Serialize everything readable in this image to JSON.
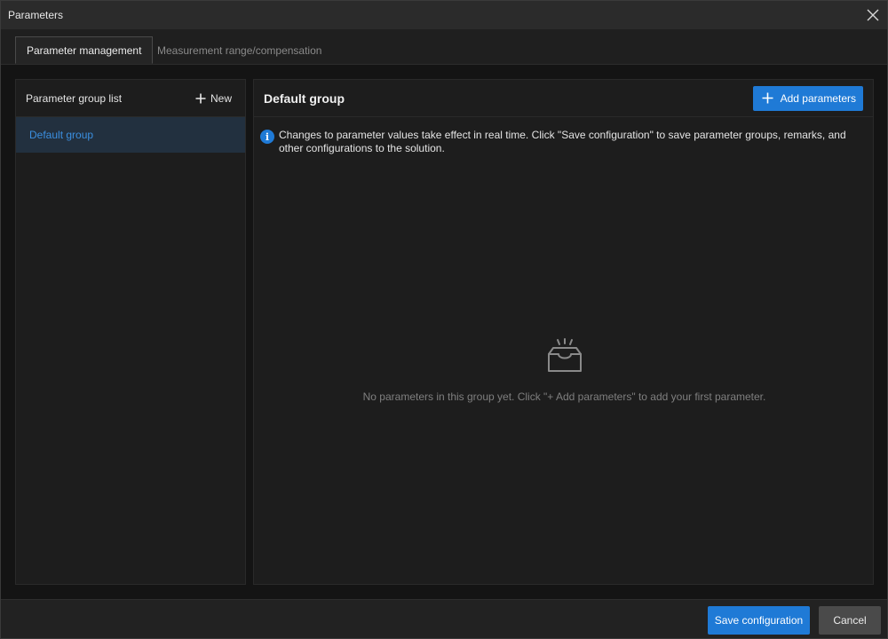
{
  "window": {
    "title": "Parameters"
  },
  "tabs": [
    {
      "label": "Parameter management",
      "active": true
    },
    {
      "label": "Measurement range/compensation",
      "active": false
    }
  ],
  "left_panel": {
    "title": "Parameter group list",
    "new_label": "New",
    "groups": [
      {
        "label": "Default group",
        "selected": true
      }
    ]
  },
  "right_panel": {
    "title": "Default group",
    "add_label": "Add parameters",
    "info": "Changes to parameter values take effect in real time. Click \"Save configuration\" to save parameter groups, remarks, and other configurations to the solution.",
    "empty_message": "No parameters in this group yet. Click \"+ Add parameters\" to add your first parameter."
  },
  "footer": {
    "save_label": "Save configuration",
    "cancel_label": "Cancel"
  },
  "colors": {
    "accent": "#1f7ad6",
    "selected_bg": "#22303f",
    "selected_text": "#3b8fe0"
  },
  "icons": {
    "close": "close-icon",
    "new": "plus-icon",
    "add": "plus-icon",
    "info": "info-icon",
    "empty": "empty-inbox-icon"
  }
}
